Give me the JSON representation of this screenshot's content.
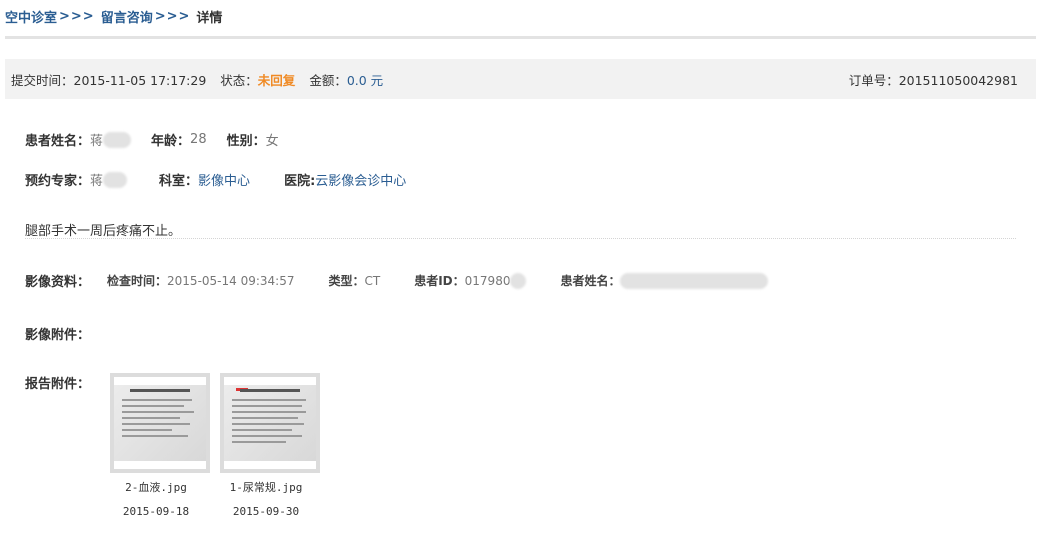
{
  "breadcrumb": {
    "items": [
      "空中诊室",
      "留言咨询",
      "详情"
    ],
    "separator": ">>>"
  },
  "info_bar": {
    "submit_label": "提交时间：",
    "submit_time": "2015-11-05 17:17:29",
    "status_label": "状态：",
    "status_value": "未回复",
    "amount_label": "金额：",
    "amount_value": "0.0 元",
    "order_label": "订单号：",
    "order_value": "201511050042981"
  },
  "patient": {
    "name_label": "患者姓名：",
    "name_value": "蒋",
    "age_label": "年龄：",
    "age_value": "28",
    "gender_label": "性别：",
    "gender_value": "女"
  },
  "appointment": {
    "expert_label": "预约专家：",
    "expert_value": "蒋",
    "dept_label": "科室：",
    "dept_value": "影像中心",
    "hospital_label": "医院:",
    "hospital_value": "云影像会诊中心"
  },
  "description": "腿部手术一周后疼痛不止。",
  "imaging": {
    "label": "影像资料：",
    "exam_time_label": "检查时间：",
    "exam_time_value": "2015-05-14 09:34:57",
    "type_label": "类型：",
    "type_value": "CT",
    "patient_id_label": "患者ID：",
    "patient_id_value": "017980",
    "patient_name_label": "患者姓名："
  },
  "image_attachments_label": "影像附件：",
  "report_attachments": {
    "label": "报告附件：",
    "files": [
      {
        "name": "2-血液.jpg",
        "date": "2015-09-18"
      },
      {
        "name": "1-尿常规.jpg",
        "date": "2015-09-30"
      }
    ]
  },
  "colors": {
    "link_blue": "#2a5d92",
    "status_orange": "#f08a24",
    "bar_gray": "#f2f2f2"
  }
}
